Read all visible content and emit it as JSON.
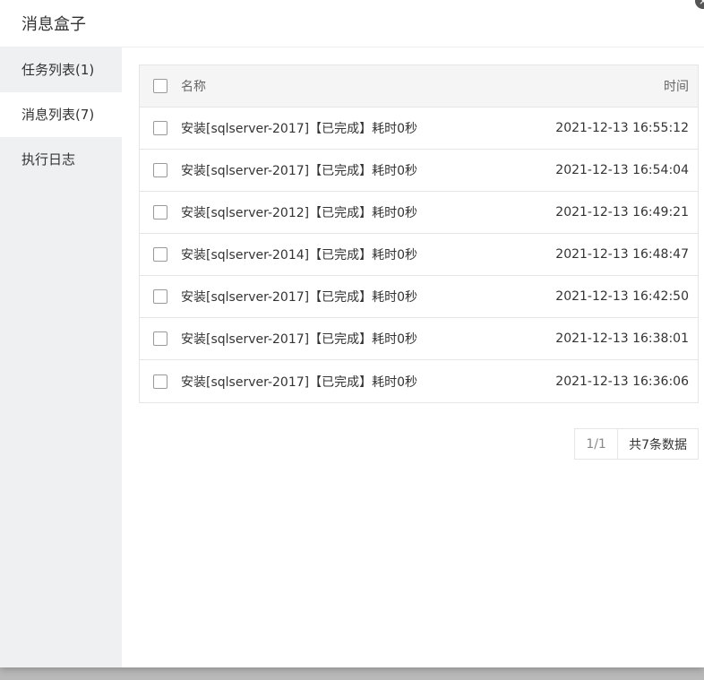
{
  "dialog": {
    "title": "消息盒子"
  },
  "sidebar": {
    "items": [
      {
        "label": "任务列表(1)"
      },
      {
        "label": "消息列表(7)"
      },
      {
        "label": "执行日志"
      }
    ]
  },
  "table": {
    "headers": {
      "name": "名称",
      "time": "时间"
    },
    "rows": [
      {
        "name": "安装[sqlserver-2017]【已完成】耗时0秒",
        "time": "2021-12-13 16:55:12"
      },
      {
        "name": "安装[sqlserver-2017]【已完成】耗时0秒",
        "time": "2021-12-13 16:54:04"
      },
      {
        "name": "安装[sqlserver-2012]【已完成】耗时0秒",
        "time": "2021-12-13 16:49:21"
      },
      {
        "name": "安装[sqlserver-2014]【已完成】耗时0秒",
        "time": "2021-12-13 16:48:47"
      },
      {
        "name": "安装[sqlserver-2017]【已完成】耗时0秒",
        "time": "2021-12-13 16:42:50"
      },
      {
        "name": "安装[sqlserver-2017]【已完成】耗时0秒",
        "time": "2021-12-13 16:38:01"
      },
      {
        "name": "安装[sqlserver-2017]【已完成】耗时0秒",
        "time": "2021-12-13 16:36:06"
      }
    ]
  },
  "pager": {
    "page": "1/1",
    "total": "共7条数据"
  }
}
